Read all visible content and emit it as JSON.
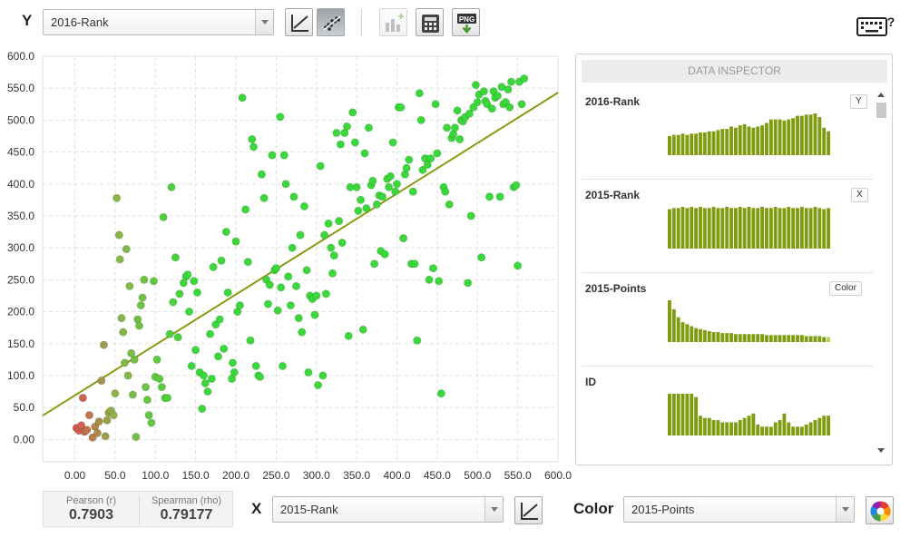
{
  "toolbar": {
    "y_label": "Y",
    "y_select": "2016-Rank",
    "x_label": "X",
    "x_select": "2015-Rank",
    "color_label": "Color",
    "color_select": "2015-Points"
  },
  "stats": {
    "pearson_label": "Pearson (r)",
    "pearson_value": "0.7903",
    "spearman_label": "Spearman (rho)",
    "spearman_value": "0.79177"
  },
  "inspector": {
    "title": "DATA INSPECTOR",
    "rows": [
      {
        "name": "2016-Rank",
        "tag": "Y",
        "hist": [
          16,
          17,
          17,
          18,
          17,
          18,
          18,
          19,
          19,
          20,
          20,
          21,
          22,
          22,
          24,
          23,
          25,
          26,
          24,
          23,
          24,
          25,
          27,
          30,
          30,
          30,
          29,
          30,
          31,
          33,
          33,
          34,
          34,
          35,
          32,
          23,
          20
        ]
      },
      {
        "name": "2015-Rank",
        "tag": "X",
        "hist": [
          34,
          35,
          35,
          36,
          35,
          36,
          35,
          36,
          35,
          35,
          36,
          35,
          35,
          36,
          35,
          35,
          36,
          35,
          36,
          35,
          35,
          36,
          35,
          35,
          36,
          35,
          35,
          36,
          35,
          35,
          36,
          35,
          35,
          36,
          35,
          34,
          35
        ]
      },
      {
        "name": "2015-Points",
        "tag": "Color",
        "hist": [
          42,
          33,
          25,
          20,
          18,
          16,
          14,
          13,
          12,
          11,
          10,
          10,
          9,
          9,
          9,
          8,
          8,
          8,
          8,
          8,
          8,
          8,
          7,
          7,
          7,
          7,
          7,
          7,
          7,
          7,
          7,
          6,
          6,
          6,
          6,
          5,
          5
        ]
      },
      {
        "name": "ID",
        "tag": "",
        "hist": [
          38,
          38,
          38,
          38,
          38,
          38,
          35,
          18,
          16,
          16,
          14,
          14,
          12,
          12,
          12,
          12,
          14,
          16,
          18,
          20,
          10,
          8,
          8,
          8,
          12,
          14,
          20,
          12,
          8,
          8,
          8,
          10,
          12,
          14,
          16,
          18,
          18
        ]
      }
    ]
  },
  "chart_data": {
    "type": "scatter",
    "title": "",
    "xlabel": "2015-Rank",
    "ylabel": "2016-Rank",
    "xlim": [
      -40,
      600
    ],
    "ylim": [
      -35,
      600
    ],
    "xticks": [
      "0.00",
      "50.0",
      "100.0",
      "150.0",
      "200.0",
      "250.0",
      "300.0",
      "350.0",
      "400.0",
      "450.0",
      "500.0",
      "550.0",
      "600.0"
    ],
    "yticks": [
      "0.00",
      "50.0",
      "100.0",
      "150.0",
      "200.0",
      "250.0",
      "300.0",
      "350.0",
      "400.0",
      "450.0",
      "500.0",
      "550.0",
      "600.0"
    ],
    "grid": true,
    "regression": {
      "slope": 0.79,
      "intercept": 69
    },
    "colors": {
      "low": "#d9534f",
      "mid": "#8db44a",
      "high": "#3bd83b",
      "line": "#8a9a12"
    },
    "color_by": "2015-Points",
    "points_note": "points listed as [x, y] in data units; color by 2015-Points (low rank = high points = red)",
    "points": [
      [
        2,
        18
      ],
      [
        5,
        14
      ],
      [
        8,
        22
      ],
      [
        12,
        12
      ],
      [
        15,
        15
      ],
      [
        10,
        65
      ],
      [
        18,
        38
      ],
      [
        22,
        3
      ],
      [
        25,
        20
      ],
      [
        28,
        10
      ],
      [
        30,
        28
      ],
      [
        33,
        92
      ],
      [
        36,
        148
      ],
      [
        38,
        5
      ],
      [
        40,
        30
      ],
      [
        42,
        42
      ],
      [
        45,
        45
      ],
      [
        48,
        38
      ],
      [
        50,
        72
      ],
      [
        52,
        378
      ],
      [
        55,
        320
      ],
      [
        56,
        282
      ],
      [
        58,
        190
      ],
      [
        60,
        168
      ],
      [
        62,
        120
      ],
      [
        64,
        298
      ],
      [
        66,
        100
      ],
      [
        68,
        240
      ],
      [
        70,
        135
      ],
      [
        72,
        70
      ],
      [
        74,
        125
      ],
      [
        76,
        4
      ],
      [
        78,
        188
      ],
      [
        80,
        178
      ],
      [
        82,
        210
      ],
      [
        84,
        222
      ],
      [
        86,
        250
      ],
      [
        88,
        82
      ],
      [
        90,
        62
      ],
      [
        92,
        38
      ],
      [
        95,
        26
      ],
      [
        98,
        248
      ],
      [
        100,
        98
      ],
      [
        102,
        125
      ],
      [
        105,
        95
      ],
      [
        108,
        82
      ],
      [
        110,
        348
      ],
      [
        112,
        65
      ],
      [
        115,
        65
      ],
      [
        118,
        165
      ],
      [
        120,
        395
      ],
      [
        122,
        215
      ],
      [
        125,
        285
      ],
      [
        128,
        160
      ],
      [
        130,
        228
      ],
      [
        135,
        245
      ],
      [
        138,
        255
      ],
      [
        140,
        258
      ],
      [
        142,
        200
      ],
      [
        145,
        115
      ],
      [
        148,
        248
      ],
      [
        150,
        140
      ],
      [
        152,
        230
      ],
      [
        155,
        105
      ],
      [
        158,
        48
      ],
      [
        160,
        100
      ],
      [
        162,
        88
      ],
      [
        165,
        75
      ],
      [
        168,
        165
      ],
      [
        170,
        95
      ],
      [
        172,
        270
      ],
      [
        175,
        180
      ],
      [
        178,
        130
      ],
      [
        180,
        188
      ],
      [
        182,
        280
      ],
      [
        185,
        142
      ],
      [
        188,
        325
      ],
      [
        190,
        230
      ],
      [
        195,
        95
      ],
      [
        196,
        120
      ],
      [
        198,
        105
      ],
      [
        200,
        310
      ],
      [
        202,
        200
      ],
      [
        205,
        210
      ],
      [
        208,
        535
      ],
      [
        212,
        360
      ],
      [
        215,
        278
      ],
      [
        218,
        155
      ],
      [
        220,
        470
      ],
      [
        222,
        458
      ],
      [
        225,
        115
      ],
      [
        228,
        100
      ],
      [
        230,
        98
      ],
      [
        232,
        415
      ],
      [
        235,
        378
      ],
      [
        238,
        250
      ],
      [
        240,
        212
      ],
      [
        242,
        242
      ],
      [
        245,
        445
      ],
      [
        248,
        265
      ],
      [
        250,
        268
      ],
      [
        252,
        202
      ],
      [
        255,
        505
      ],
      [
        256,
        238
      ],
      [
        258,
        115
      ],
      [
        260,
        445
      ],
      [
        262,
        400
      ],
      [
        265,
        255
      ],
      [
        268,
        210
      ],
      [
        270,
        300
      ],
      [
        272,
        380
      ],
      [
        275,
        240
      ],
      [
        278,
        190
      ],
      [
        280,
        320
      ],
      [
        282,
        168
      ],
      [
        285,
        365
      ],
      [
        288,
        265
      ],
      [
        290,
        105
      ],
      [
        292,
        225
      ],
      [
        295,
        220
      ],
      [
        298,
        195
      ],
      [
        300,
        225
      ],
      [
        302,
        85
      ],
      [
        305,
        428
      ],
      [
        308,
        100
      ],
      [
        310,
        320
      ],
      [
        312,
        228
      ],
      [
        315,
        338
      ],
      [
        318,
        300
      ],
      [
        320,
        260
      ],
      [
        322,
        288
      ],
      [
        325,
        480
      ],
      [
        328,
        342
      ],
      [
        330,
        462
      ],
      [
        332,
        308
      ],
      [
        335,
        480
      ],
      [
        338,
        490
      ],
      [
        340,
        162
      ],
      [
        342,
        395
      ],
      [
        345,
        512
      ],
      [
        348,
        465
      ],
      [
        350,
        395
      ],
      [
        352,
        358
      ],
      [
        355,
        375
      ],
      [
        358,
        172
      ],
      [
        360,
        448
      ],
      [
        362,
        362
      ],
      [
        365,
        488
      ],
      [
        368,
        398
      ],
      [
        370,
        405
      ],
      [
        372,
        275
      ],
      [
        375,
        368
      ],
      [
        378,
        382
      ],
      [
        380,
        295
      ],
      [
        382,
        380
      ],
      [
        385,
        290
      ],
      [
        388,
        408
      ],
      [
        390,
        395
      ],
      [
        392,
        412
      ],
      [
        395,
        465
      ],
      [
        398,
        388
      ],
      [
        400,
        400
      ],
      [
        402,
        520
      ],
      [
        405,
        520
      ],
      [
        408,
        315
      ],
      [
        410,
        415
      ],
      [
        412,
        425
      ],
      [
        415,
        438
      ],
      [
        418,
        275
      ],
      [
        420,
        388
      ],
      [
        422,
        275
      ],
      [
        425,
        155
      ],
      [
        428,
        542
      ],
      [
        430,
        500
      ],
      [
        432,
        422
      ],
      [
        435,
        440
      ],
      [
        438,
        430
      ],
      [
        440,
        250
      ],
      [
        442,
        440
      ],
      [
        445,
        268
      ],
      [
        448,
        525
      ],
      [
        450,
        448
      ],
      [
        452,
        248
      ],
      [
        455,
        72
      ],
      [
        458,
        395
      ],
      [
        460,
        388
      ],
      [
        462,
        488
      ],
      [
        465,
        368
      ],
      [
        468,
        472
      ],
      [
        470,
        478
      ],
      [
        472,
        488
      ],
      [
        475,
        515
      ],
      [
        478,
        470
      ],
      [
        480,
        500
      ],
      [
        482,
        498
      ],
      [
        485,
        505
      ],
      [
        488,
        245
      ],
      [
        490,
        510
      ],
      [
        492,
        350
      ],
      [
        495,
        520
      ],
      [
        498,
        555
      ],
      [
        500,
        528
      ],
      [
        502,
        540
      ],
      [
        505,
        285
      ],
      [
        508,
        545
      ],
      [
        510,
        530
      ],
      [
        512,
        525
      ],
      [
        515,
        380
      ],
      [
        518,
        518
      ],
      [
        520,
        545
      ],
      [
        522,
        535
      ],
      [
        525,
        538
      ],
      [
        528,
        380
      ],
      [
        530,
        552
      ],
      [
        532,
        525
      ],
      [
        535,
        528
      ],
      [
        538,
        548
      ],
      [
        540,
        520
      ],
      [
        542,
        560
      ],
      [
        545,
        395
      ],
      [
        548,
        398
      ],
      [
        550,
        272
      ],
      [
        552,
        560
      ],
      [
        555,
        525
      ],
      [
        558,
        565
      ]
    ]
  }
}
